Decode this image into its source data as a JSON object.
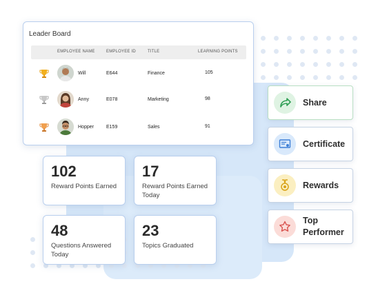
{
  "leaderboard": {
    "title": "Leader Board",
    "columns": [
      "EMPLOYEE NAME",
      "EMPLOYEE ID",
      "TITLE",
      "LEARNING POINTS"
    ],
    "rows": [
      {
        "name": "Will",
        "id": "E644",
        "title": "Finance",
        "points": "105",
        "trophy": "gold-trophy-icon"
      },
      {
        "name": "Anny",
        "id": "E078",
        "title": "Marketing",
        "points": "98",
        "trophy": "silver-trophy-icon"
      },
      {
        "name": "Hopper",
        "id": "E159",
        "title": "Sales",
        "points": "91",
        "trophy": "bronze-trophy-icon"
      }
    ]
  },
  "stats": [
    {
      "value": "102",
      "label": "Reward Points Earned"
    },
    {
      "value": "17",
      "label": "Reward Points Earned Today"
    },
    {
      "value": "48",
      "label": "Questions Answered Today"
    },
    {
      "value": "23",
      "label": "Topics Graduated"
    }
  ],
  "actions": [
    {
      "label": "Share",
      "icon": "share-arrow-icon",
      "color": "#2f9e55",
      "bg": "#dff3e3"
    },
    {
      "label": "Certificate",
      "icon": "certificate-icon",
      "color": "#3d7fd6",
      "bg": "#d9e9fb"
    },
    {
      "label": "Rewards",
      "icon": "medal-icon",
      "color": "#d9a31a",
      "bg": "#fbefc1"
    },
    {
      "label": "Top Performer",
      "icon": "star-icon",
      "color": "#d9534f",
      "bg": "#fbdcd8"
    }
  ],
  "colors": {
    "card_border": "#b9cfee",
    "bg_accent": "#cfe3f8"
  }
}
